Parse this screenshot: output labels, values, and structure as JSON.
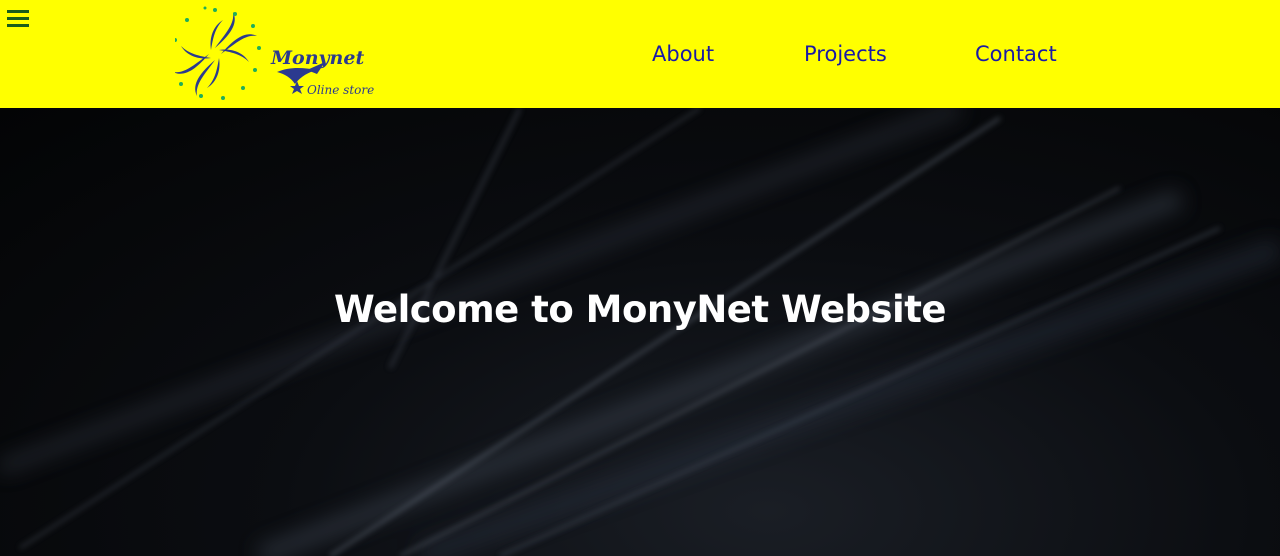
{
  "header": {
    "background": "#ffff00",
    "menu_icon": "hamburger-menu-icon",
    "logo": {
      "brand": "Monynet",
      "tagline": "Oline store",
      "colors": {
        "swirl": "#2b3a8f",
        "dots": "#1fae5a"
      }
    },
    "nav": [
      {
        "label": "About"
      },
      {
        "label": "Projects"
      },
      {
        "label": "Contact"
      }
    ],
    "nav_color": "#1a1aa6"
  },
  "hero": {
    "title": "Welcome to MonyNet Website",
    "background": "#050608"
  }
}
